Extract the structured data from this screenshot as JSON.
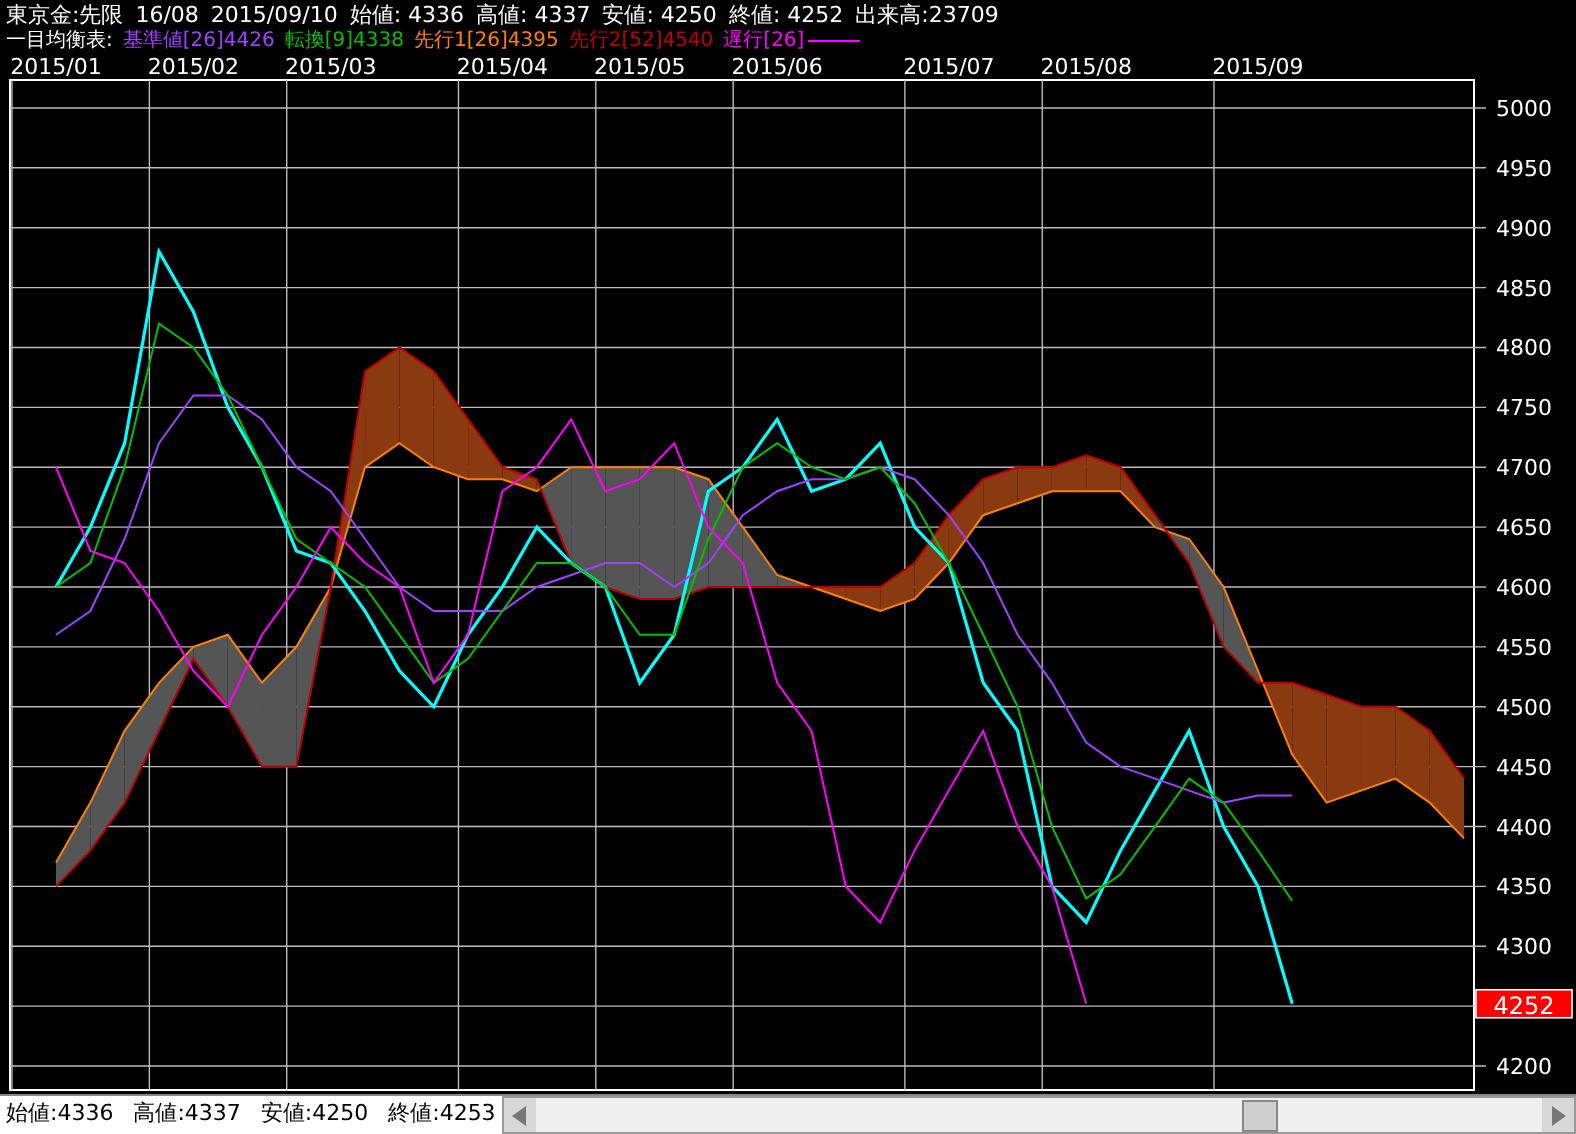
{
  "header": [
    "東京金:先限",
    "16/08",
    "2015/09/10",
    "始値: 4336",
    "高値: 4337",
    "安値: 4250",
    "終値: 4252",
    "出来高:23709"
  ],
  "legend": {
    "title": "一目均衡表:",
    "items": [
      {
        "label": "基準値[26]4426",
        "color": "#a040ff",
        "kind": "text"
      },
      {
        "label": "転換[9]4338",
        "color": "#00c000",
        "kind": "text"
      },
      {
        "label": "先行1[26]4395",
        "color": "#ff8000",
        "kind": "text"
      },
      {
        "label": "先行2[52]4540",
        "color": "#c00000",
        "kind": "text"
      },
      {
        "label": "遅行[26]",
        "color": "#ff00ff",
        "kind": "line"
      }
    ]
  },
  "chart": {
    "price_tag": "4252",
    "chart_data": {
      "type": "line",
      "categories": [
        "2015/01",
        null,
        null,
        null,
        "2015/02",
        null,
        null,
        null,
        "2015/03",
        null,
        null,
        null,
        null,
        "2015/04",
        null,
        null,
        null,
        "2015/05",
        null,
        null,
        null,
        "2015/06",
        null,
        null,
        null,
        null,
        "2015/07",
        null,
        null,
        null,
        "2015/08",
        null,
        null,
        null,
        null,
        "2015/09",
        null,
        null,
        null,
        null,
        null,
        null
      ],
      "ylim": [
        4180,
        5025
      ],
      "grid": true,
      "yticks": [
        4200,
        4300,
        4350,
        4400,
        4450,
        4500,
        4550,
        4600,
        4650,
        4700,
        4750,
        4800,
        4850,
        4900,
        4950,
        5000
      ],
      "series": [
        {
          "color": "#00ffff",
          "values": [
            4600,
            4650,
            4720,
            4880,
            4830,
            4750,
            4700,
            4630,
            4620,
            4580,
            4530,
            4500,
            4560,
            4600,
            4650,
            4620,
            4600,
            4520,
            4560,
            4680,
            4700,
            4740,
            4680,
            4690,
            4720,
            4650,
            4620,
            4520,
            4480,
            4350,
            4320,
            4380,
            4430,
            4480,
            4400,
            4350,
            4252,
            null,
            null,
            null,
            null,
            null
          ]
        },
        {
          "color": "#a040ff",
          "values": [
            4560,
            4580,
            4640,
            4720,
            4760,
            4760,
            4740,
            4700,
            4680,
            4640,
            4600,
            4580,
            4580,
            4580,
            4600,
            4610,
            4620,
            4620,
            4600,
            4620,
            4660,
            4680,
            4690,
            4690,
            4700,
            4690,
            4660,
            4620,
            4560,
            4520,
            4470,
            4450,
            4440,
            4430,
            4420,
            4426,
            4426,
            null,
            null,
            null,
            null,
            null
          ]
        },
        {
          "color": "#00c000",
          "values": [
            4600,
            4620,
            4700,
            4820,
            4800,
            4760,
            4700,
            4640,
            4620,
            4600,
            4560,
            4520,
            4540,
            4580,
            4620,
            4620,
            4600,
            4560,
            4560,
            4640,
            4700,
            4720,
            4700,
            4690,
            4700,
            4670,
            4620,
            4560,
            4500,
            4400,
            4340,
            4360,
            4400,
            4440,
            4420,
            4380,
            4338,
            null,
            null,
            null,
            null,
            null
          ]
        },
        {
          "color": "#ff8000",
          "values": [
            4370,
            4420,
            4480,
            4520,
            4550,
            4560,
            4520,
            4550,
            4600,
            4700,
            4720,
            4700,
            4690,
            4690,
            4680,
            4700,
            4700,
            4700,
            4700,
            4690,
            4650,
            4610,
            4600,
            4590,
            4580,
            4590,
            4620,
            4660,
            4670,
            4680,
            4680,
            4680,
            4650,
            4640,
            4600,
            4530,
            4460,
            4420,
            4430,
            4440,
            4420,
            4390
          ]
        },
        {
          "color": "#c00000",
          "values": [
            4350,
            4380,
            4420,
            4480,
            4540,
            4500,
            4450,
            4450,
            4600,
            4780,
            4800,
            4780,
            4740,
            4700,
            4690,
            4620,
            4600,
            4590,
            4590,
            4600,
            4600,
            4600,
            4600,
            4600,
            4600,
            4620,
            4660,
            4690,
            4700,
            4700,
            4710,
            4700,
            4660,
            4620,
            4550,
            4520,
            4520,
            4510,
            4500,
            4500,
            4480,
            4440
          ]
        },
        {
          "color": "#ff00ff",
          "values": [
            4700,
            4630,
            4620,
            4580,
            4530,
            4500,
            4560,
            4600,
            4650,
            4620,
            4600,
            4520,
            4560,
            4680,
            4700,
            4740,
            4680,
            4690,
            4720,
            4650,
            4620,
            4520,
            4480,
            4350,
            4320,
            4380,
            4430,
            4480,
            4400,
            4350,
            4252,
            null,
            null,
            null,
            null,
            null,
            null,
            null,
            null,
            null,
            null,
            null
          ]
        }
      ]
    }
  },
  "status": [
    "始値:4336",
    "高値:4337",
    "安値:4250",
    "終値:4253"
  ]
}
